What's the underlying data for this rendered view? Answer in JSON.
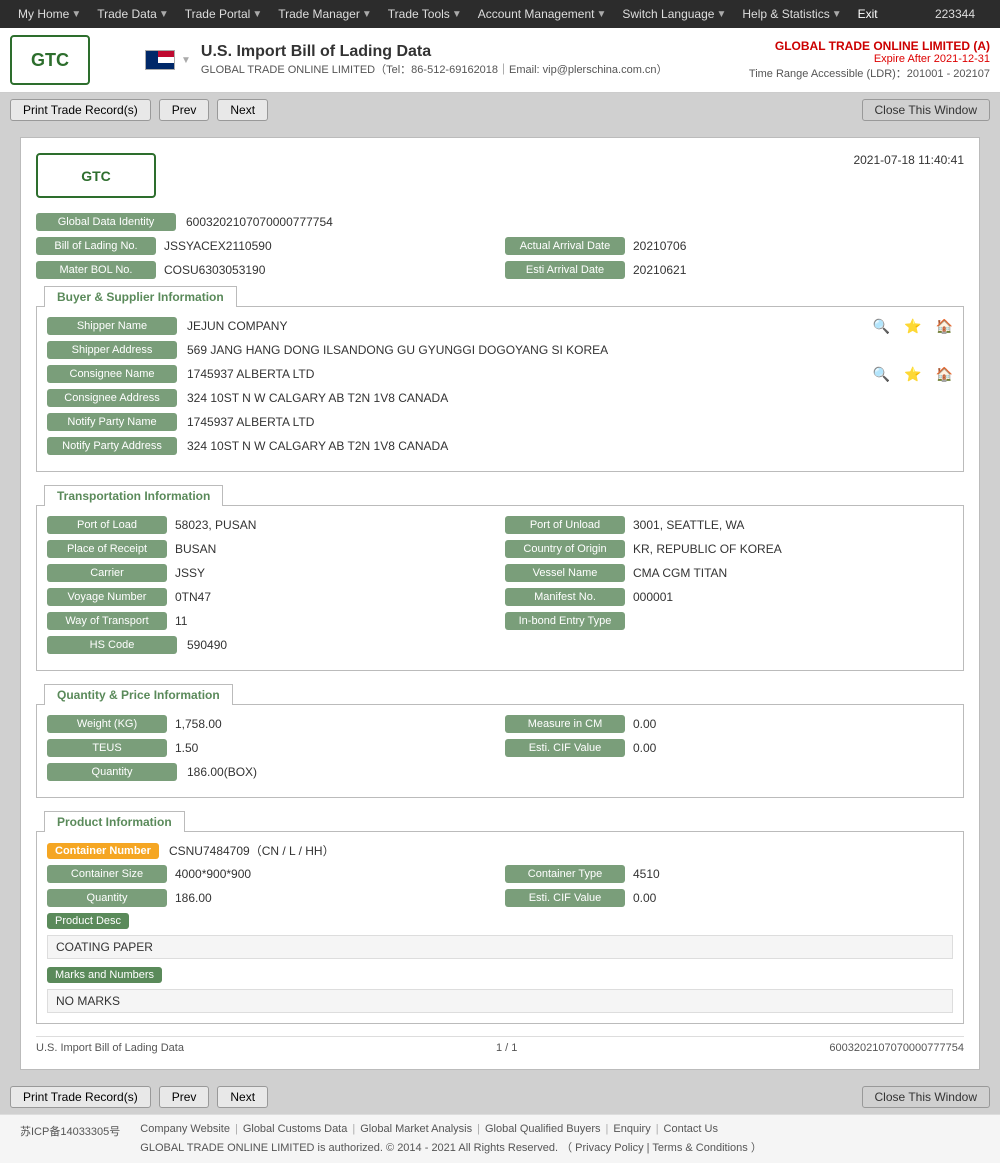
{
  "topnav": {
    "user_id": "223344",
    "items": [
      {
        "label": "My Home",
        "id": "my-home"
      },
      {
        "label": "Trade Data",
        "id": "trade-data"
      },
      {
        "label": "Trade Portal",
        "id": "trade-portal"
      },
      {
        "label": "Trade Manager",
        "id": "trade-manager"
      },
      {
        "label": "Trade Tools",
        "id": "trade-tools"
      },
      {
        "label": "Account Management",
        "id": "account-management"
      },
      {
        "label": "Switch Language",
        "id": "switch-language"
      },
      {
        "label": "Help & Statistics",
        "id": "help-statistics"
      },
      {
        "label": "Exit",
        "id": "exit"
      }
    ]
  },
  "header": {
    "logo": "GTO",
    "title": "U.S. Import Bill of Lading Data",
    "company_full": "GLOBAL TRADE ONLINE LIMITED（Tel：86-512-69162018｜Email: vip@plerschina.com.cn）",
    "account_company": "GLOBAL TRADE ONLINE LIMITED (A)",
    "expire_label": "Expire After 2021-12-31",
    "ldr_label": "Time Range Accessible (LDR)：201001 - 202107"
  },
  "toolbar": {
    "print_label": "Print Trade Record(s)",
    "prev_label": "Prev",
    "next_label": "Next",
    "close_label": "Close This Window"
  },
  "record": {
    "date": "2021-07-18 11:40:41",
    "logo": "GTO",
    "global_data_identity_label": "Global Data Identity",
    "global_data_identity_value": "6003202107070000777754",
    "bill_of_lading_no_label": "Bill of Lading No.",
    "bill_of_lading_no_value": "JSSYACEX2110590",
    "actual_arrival_date_label": "Actual Arrival Date",
    "actual_arrival_date_value": "20210706",
    "mater_bol_no_label": "Mater BOL No.",
    "mater_bol_no_value": "COSU6303053190",
    "esti_arrival_date_label": "Esti Arrival Date",
    "esti_arrival_date_value": "20210621"
  },
  "buyer_supplier": {
    "section_title": "Buyer & Supplier Information",
    "shipper_name_label": "Shipper Name",
    "shipper_name_value": "JEJUN COMPANY",
    "shipper_address_label": "Shipper Address",
    "shipper_address_value": "569 JANG HANG DONG ILSANDONG GU GYUNGGI DOGOYANG SI KOREA",
    "consignee_name_label": "Consignee Name",
    "consignee_name_value": "1745937 ALBERTA LTD",
    "consignee_address_label": "Consignee Address",
    "consignee_address_value": "324 10ST N W CALGARY AB T2N 1V8 CANADA",
    "notify_party_name_label": "Notify Party Name",
    "notify_party_name_value": "1745937 ALBERTA LTD",
    "notify_party_address_label": "Notify Party Address",
    "notify_party_address_value": "324 10ST N W CALGARY AB T2N 1V8 CANADA"
  },
  "transportation": {
    "section_title": "Transportation Information",
    "port_of_load_label": "Port of Load",
    "port_of_load_value": "58023, PUSAN",
    "port_of_unload_label": "Port of Unload",
    "port_of_unload_value": "3001, SEATTLE, WA",
    "place_of_receipt_label": "Place of Receipt",
    "place_of_receipt_value": "BUSAN",
    "country_of_origin_label": "Country of Origin",
    "country_of_origin_value": "KR, REPUBLIC OF KOREA",
    "carrier_label": "Carrier",
    "carrier_value": "JSSY",
    "vessel_name_label": "Vessel Name",
    "vessel_name_value": "CMA CGM TITAN",
    "voyage_number_label": "Voyage Number",
    "voyage_number_value": "0TN47",
    "manifest_no_label": "Manifest No.",
    "manifest_no_value": "000001",
    "way_of_transport_label": "Way of Transport",
    "way_of_transport_value": "11",
    "in_bond_entry_type_label": "In-bond Entry Type",
    "in_bond_entry_type_value": "",
    "hs_code_label": "HS Code",
    "hs_code_value": "590490"
  },
  "quantity_price": {
    "section_title": "Quantity & Price Information",
    "weight_kg_label": "Weight (KG)",
    "weight_kg_value": "1,758.00",
    "measure_in_cm_label": "Measure in CM",
    "measure_in_cm_value": "0.00",
    "teus_label": "TEUS",
    "teus_value": "1.50",
    "esti_cif_value_label": "Esti. CIF Value",
    "esti_cif_value": "0.00",
    "quantity_label": "Quantity",
    "quantity_value": "186.00(BOX)"
  },
  "product": {
    "section_title": "Product Information",
    "container_number_label": "Container Number",
    "container_number_value": "CSNU7484709（CN / L / HH）",
    "container_size_label": "Container Size",
    "container_size_value": "4000*900*900",
    "container_type_label": "Container Type",
    "container_type_value": "4510",
    "quantity_label": "Quantity",
    "quantity_value": "186.00",
    "esti_cif_value_label": "Esti. CIF Value",
    "esti_cif_value": "0.00",
    "product_desc_label": "Product Desc",
    "product_desc_value": "COATING PAPER",
    "marks_and_numbers_label": "Marks and Numbers",
    "marks_and_numbers_value": "NO MARKS"
  },
  "record_footer": {
    "title": "U.S. Import Bill of Lading Data",
    "page": "1 / 1",
    "record_id": "6003202107070000777754"
  },
  "bottom_toolbar": {
    "print_label": "Print Trade Record(s)",
    "prev_label": "Prev",
    "next_label": "Next",
    "close_label": "Close This Window"
  },
  "page_footer": {
    "icp": "苏ICP备14033305号",
    "links": [
      "Company Website",
      "Global Customs Data",
      "Global Market Analysis",
      "Global Qualified Buyers",
      "Enquiry",
      "Contact Us"
    ],
    "copyright": "GLOBAL TRADE ONLINE LIMITED is authorized. © 2014 - 2021 All Rights Reserved.",
    "privacy_policy": "Privacy Policy",
    "terms_conditions": "Terms & Conditions"
  }
}
